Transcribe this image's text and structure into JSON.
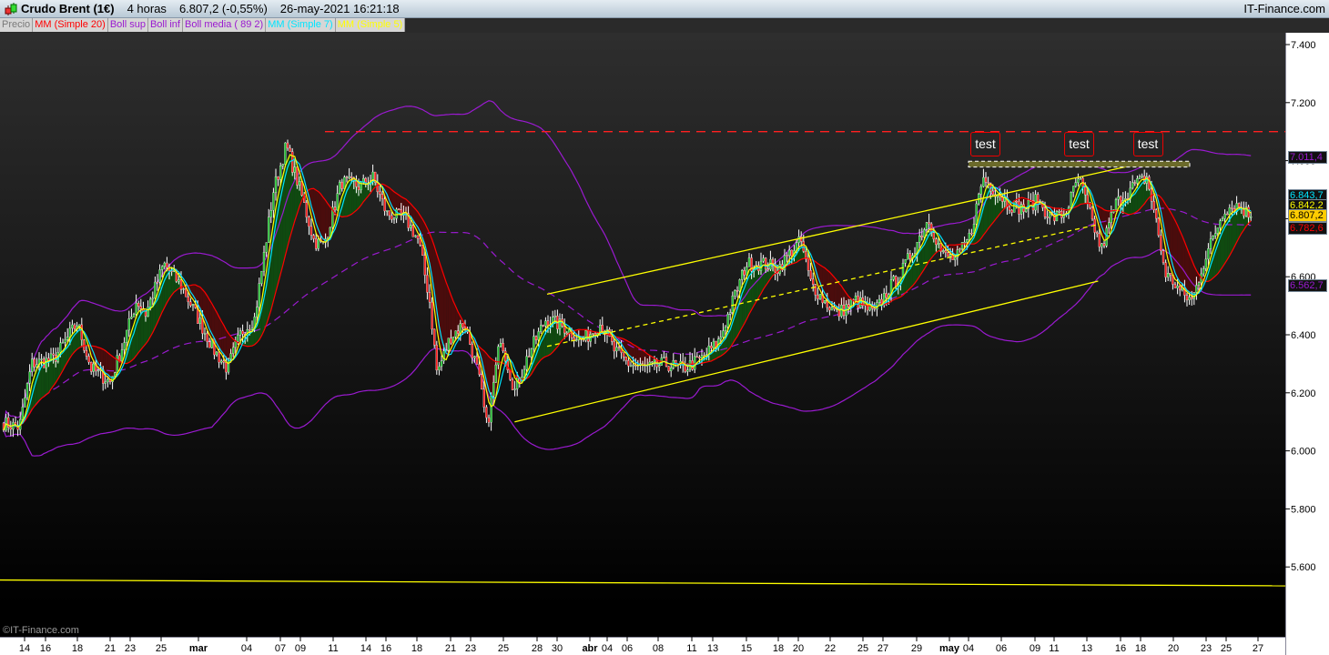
{
  "header": {
    "instrument": "Crudo Brent (1€)",
    "timeframe": "4 horas",
    "last": "6.807,2 (-0,55%)",
    "datetime": "26-may-2021 16:21:18",
    "brand": "IT-Finance.com"
  },
  "legend": [
    {
      "label": "Precio",
      "color": "#7a7a7a"
    },
    {
      "label": "MM (Simple 20)",
      "color": "#ff0000"
    },
    {
      "label": "Boll sup",
      "color": "#9a1ad0"
    },
    {
      "label": "Boll inf",
      "color": "#9a1ad0"
    },
    {
      "label": "Boll media ( 89 2)",
      "color": "#9a1ad0"
    },
    {
      "label": "MM (Simple 7)",
      "color": "#00e5ff"
    },
    {
      "label": "MM (Simple 5)",
      "color": "#ffff00"
    }
  ],
  "watermark": "©IT-Finance.com",
  "price_labels": [
    {
      "value": "7.011,4",
      "color": "#9a1ad0",
      "bg": "#111",
      "price": 7.0114
    },
    {
      "value": "6.843,7",
      "color": "#00e5ff",
      "bg": "#111",
      "price": 6.8437
    },
    {
      "value": "6.842,2",
      "color": "#ffff00",
      "bg": "#111",
      "price": 6.8422
    },
    {
      "value": "6.807,2",
      "color": "#000000",
      "bg": "#ffcc00",
      "price": 6.8072
    },
    {
      "value": "6.782,6",
      "color": "#ff0000",
      "bg": "#111",
      "price": 6.7826
    },
    {
      "value": "6.562,7",
      "color": "#9a1ad0",
      "bg": "#111",
      "price": 6.5627
    }
  ],
  "annotations": {
    "labels": [
      "test",
      "test",
      "test"
    ]
  },
  "chart_data": {
    "type": "candlestick",
    "ylim": [
      5.45,
      7.45
    ],
    "y_ticks": [
      "7.400",
      "7.200",
      "7.000",
      "6.800",
      "6.600",
      "6.400",
      "6.200",
      "6.000",
      "5.800",
      "5.600"
    ],
    "y_tick_values": [
      7.4,
      7.2,
      7.0,
      6.8,
      6.6,
      6.4,
      6.2,
      6.0,
      5.8,
      5.6
    ],
    "x_ticks": [
      {
        "label": "14",
        "date": "2021-02-14"
      },
      {
        "label": "16",
        "date": "2021-02-16"
      },
      {
        "label": "18",
        "date": "2021-02-18"
      },
      {
        "label": "21",
        "date": "2021-02-21"
      },
      {
        "label": "23",
        "date": "2021-02-23"
      },
      {
        "label": "25",
        "date": "2021-02-25"
      },
      {
        "label": "mar",
        "date": "2021-03-01",
        "bold": true
      },
      {
        "label": "04",
        "date": "2021-03-04"
      },
      {
        "label": "07",
        "date": "2021-03-07"
      },
      {
        "label": "09",
        "date": "2021-03-09"
      },
      {
        "label": "11",
        "date": "2021-03-11"
      },
      {
        "label": "14",
        "date": "2021-03-14"
      },
      {
        "label": "16",
        "date": "2021-03-16"
      },
      {
        "label": "18",
        "date": "2021-03-18"
      },
      {
        "label": "21",
        "date": "2021-03-21"
      },
      {
        "label": "23",
        "date": "2021-03-23"
      },
      {
        "label": "25",
        "date": "2021-03-25"
      },
      {
        "label": "28",
        "date": "2021-03-28"
      },
      {
        "label": "30",
        "date": "2021-03-30"
      },
      {
        "label": "abr",
        "date": "2021-04-01",
        "bold": true
      },
      {
        "label": "04",
        "date": "2021-04-04"
      },
      {
        "label": "06",
        "date": "2021-04-06"
      },
      {
        "label": "08",
        "date": "2021-04-08"
      },
      {
        "label": "11",
        "date": "2021-04-11"
      },
      {
        "label": "13",
        "date": "2021-04-13"
      },
      {
        "label": "15",
        "date": "2021-04-15"
      },
      {
        "label": "18",
        "date": "2021-04-18"
      },
      {
        "label": "20",
        "date": "2021-04-20"
      },
      {
        "label": "22",
        "date": "2021-04-22"
      },
      {
        "label": "25",
        "date": "2021-04-25"
      },
      {
        "label": "27",
        "date": "2021-04-27"
      },
      {
        "label": "29",
        "date": "2021-04-29"
      },
      {
        "label": "may",
        "date": "2021-05-02",
        "bold": true
      },
      {
        "label": "04",
        "date": "2021-05-04"
      },
      {
        "label": "06",
        "date": "2021-05-06"
      },
      {
        "label": "09",
        "date": "2021-05-09"
      },
      {
        "label": "11",
        "date": "2021-05-11"
      },
      {
        "label": "13",
        "date": "2021-05-13"
      },
      {
        "label": "16",
        "date": "2021-05-16"
      },
      {
        "label": "18",
        "date": "2021-05-18"
      },
      {
        "label": "20",
        "date": "2021-05-20"
      },
      {
        "label": "23",
        "date": "2021-05-23"
      },
      {
        "label": "25",
        "date": "2021-05-25"
      },
      {
        "label": "27",
        "date": "2021-05-27"
      }
    ],
    "close_path": [
      [
        "2021-02-12T00",
        6.096
      ],
      [
        "2021-02-13T12",
        6.08
      ],
      [
        "2021-02-14T16",
        6.3
      ],
      [
        "2021-02-16T12",
        6.315
      ],
      [
        "2021-02-18T00",
        6.441
      ],
      [
        "2021-02-19T06",
        6.284
      ],
      [
        "2021-02-21T00",
        6.237
      ],
      [
        "2021-02-22T06",
        6.362
      ],
      [
        "2021-02-23T10",
        6.519
      ],
      [
        "2021-02-24T00",
        6.472
      ],
      [
        "2021-02-25T07",
        6.644
      ],
      [
        "2021-02-27T05",
        6.566
      ],
      [
        "2021-02-28T17",
        6.472
      ],
      [
        "2021-03-01T23",
        6.347
      ],
      [
        "2021-03-02T19",
        6.284
      ],
      [
        "2021-03-03T16",
        6.409
      ],
      [
        "2021-03-04T17",
        6.456
      ],
      [
        "2021-03-06T09",
        6.895
      ],
      [
        "2021-03-07T14",
        7.052
      ],
      [
        "2021-03-09T00",
        6.895
      ],
      [
        "2021-03-09T20",
        6.723
      ],
      [
        "2021-03-10T10",
        6.707
      ],
      [
        "2021-03-11T18",
        6.927
      ],
      [
        "2021-03-13T10",
        6.911
      ],
      [
        "2021-03-14T17",
        6.942
      ],
      [
        "2021-03-16T01",
        6.817
      ],
      [
        "2021-03-17T06",
        6.801
      ],
      [
        "2021-03-18T04",
        6.723
      ],
      [
        "2021-03-19T03",
        6.519
      ],
      [
        "2021-03-19T19",
        6.268
      ],
      [
        "2021-03-21T00",
        6.394
      ],
      [
        "2021-03-22T09",
        6.441
      ],
      [
        "2021-03-23T11",
        6.268
      ],
      [
        "2021-03-24T00",
        6.08
      ],
      [
        "2021-03-24T20",
        6.394
      ],
      [
        "2021-03-26T00",
        6.206
      ],
      [
        "2021-03-27T05",
        6.331
      ],
      [
        "2021-03-28T22",
        6.456
      ],
      [
        "2021-03-30T11",
        6.425
      ],
      [
        "2021-03-31T13",
        6.378
      ],
      [
        "2021-04-02T22",
        6.441
      ],
      [
        "2021-04-04T17",
        6.347
      ],
      [
        "2021-04-06T02",
        6.3
      ],
      [
        "2021-04-07T06",
        6.284
      ],
      [
        "2021-04-08T14",
        6.3
      ],
      [
        "2021-04-10T05",
        6.284
      ],
      [
        "2021-04-11T21",
        6.315
      ],
      [
        "2021-04-13T09",
        6.378
      ],
      [
        "2021-04-14T05",
        6.519
      ],
      [
        "2021-04-15T00",
        6.644
      ],
      [
        "2021-04-16T17",
        6.644
      ],
      [
        "2021-04-18T00",
        6.629
      ],
      [
        "2021-04-19T09",
        6.691
      ],
      [
        "2021-04-20T04",
        6.723
      ],
      [
        "2021-04-20T18",
        6.582
      ],
      [
        "2021-04-21T14",
        6.519
      ],
      [
        "2021-04-22T16",
        6.472
      ],
      [
        "2021-04-24T08",
        6.519
      ],
      [
        "2021-04-26T02",
        6.472
      ],
      [
        "2021-04-27T06",
        6.55
      ],
      [
        "2021-04-28T02",
        6.613
      ],
      [
        "2021-04-28T22",
        6.707
      ],
      [
        "2021-04-30T02",
        6.801
      ],
      [
        "2021-05-01T08",
        6.676
      ],
      [
        "2021-05-02T16",
        6.66
      ],
      [
        "2021-05-04T02",
        6.739
      ],
      [
        "2021-05-04T21",
        6.942
      ],
      [
        "2021-05-05T16",
        6.895
      ],
      [
        "2021-05-06T20",
        6.848
      ],
      [
        "2021-05-08T00",
        6.833
      ],
      [
        "2021-05-09T07",
        6.864
      ],
      [
        "2021-05-10T17",
        6.801
      ],
      [
        "2021-05-11T16",
        6.817
      ],
      [
        "2021-05-12T12",
        6.942
      ],
      [
        "2021-05-13T00",
        6.848
      ],
      [
        "2021-05-14T07",
        6.691
      ],
      [
        "2021-05-15T12",
        6.848
      ],
      [
        "2021-05-17T06",
        6.911
      ],
      [
        "2021-05-18T09",
        6.942
      ],
      [
        "2021-05-18T22",
        6.801
      ],
      [
        "2021-05-19T12",
        6.613
      ],
      [
        "2021-05-20T00",
        6.582
      ],
      [
        "2021-05-20T22",
        6.535
      ],
      [
        "2021-05-21T18",
        6.519
      ],
      [
        "2021-05-22T14",
        6.629
      ],
      [
        "2021-05-23T22",
        6.754
      ],
      [
        "2021-05-24T19",
        6.833
      ],
      [
        "2021-05-25T18",
        6.848
      ],
      [
        "2021-05-26T14",
        6.807
      ]
    ],
    "indicators": {
      "sma_fast": 5,
      "sma_mid": 7,
      "sma_slow": 20,
      "bollinger_period": 89,
      "bollinger_k": 2
    },
    "colors": {
      "up": "#22c030",
      "down": "#ff2020",
      "wick": "#ffffff",
      "sma5": "#ffff00",
      "sma7": "#00e5ff",
      "sma20": "#ff0000",
      "boll": "#9a1ad0",
      "fill_up": "#0f4a10",
      "fill_down": "#4a0c0c",
      "trend": "#ffff00",
      "resistance": "#ff2020"
    },
    "drawings": {
      "resistance_price": 7.1,
      "resistance_from": "2021-03-10T12",
      "support_line": [
        [
          "2021-02-12T00",
          5.555
        ],
        [
          "2021-05-28T00",
          5.535
        ]
      ],
      "channel_upper": [
        [
          "2021-03-29T00",
          6.54
        ],
        [
          "2021-05-18T00",
          6.99
        ]
      ],
      "channel_lower": [
        [
          "2021-03-26T00",
          6.1
        ],
        [
          "2021-05-14T00",
          6.585
        ]
      ],
      "channel_mid": [
        [
          "2021-03-29T00",
          6.36
        ],
        [
          "2021-05-14T00",
          6.78
        ]
      ],
      "resistance_zone": {
        "from": "2021-05-04T00",
        "to": "2021-05-21T12",
        "top": 6.998,
        "bottom": 6.978
      },
      "test_dates": [
        "2021-05-05T00",
        "2021-05-12T12",
        "2021-05-18T10"
      ]
    }
  }
}
